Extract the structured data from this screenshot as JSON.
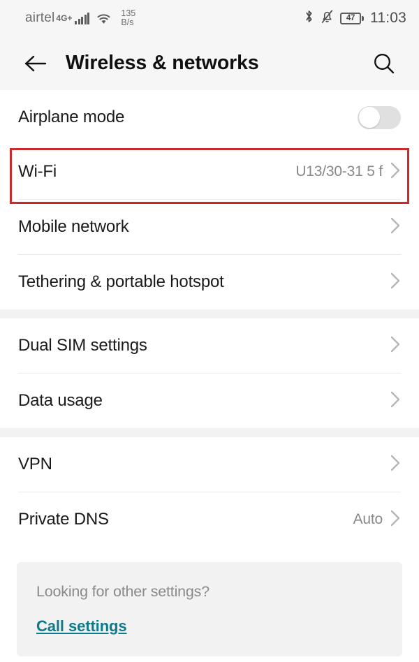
{
  "statusbar": {
    "carrier": "airtel",
    "network_type": "4G+",
    "signal_icon": "signal-bars-icon",
    "wifi_icon": "wifi-icon",
    "speed_value": "135",
    "speed_unit": "B/s",
    "bluetooth_icon": "bluetooth-icon",
    "silent_icon": "bell-muted-icon",
    "battery_percent": "47",
    "time": "11:03"
  },
  "appbar": {
    "back_icon": "back-arrow-icon",
    "title": "Wireless & networks",
    "search_icon": "search-icon"
  },
  "groups": [
    {
      "rows": [
        {
          "label": "Airplane mode",
          "value": "",
          "control": "toggle",
          "toggle_on": false
        }
      ]
    },
    {
      "rows": [
        {
          "label": "Wi-Fi",
          "value": "U13/30-31 5 f",
          "control": "chevron",
          "highlighted": true
        },
        {
          "label": "Mobile network",
          "value": "",
          "control": "chevron"
        },
        {
          "label": "Tethering & portable hotspot",
          "value": "",
          "control": "chevron"
        }
      ]
    },
    {
      "rows": [
        {
          "label": "Dual SIM settings",
          "value": "",
          "control": "chevron"
        },
        {
          "label": "Data usage",
          "value": "",
          "control": "chevron"
        }
      ]
    },
    {
      "rows": [
        {
          "label": "VPN",
          "value": "",
          "control": "chevron"
        },
        {
          "label": "Private DNS",
          "value": "Auto",
          "control": "chevron"
        }
      ]
    }
  ],
  "footer": {
    "question": "Looking for other settings?",
    "link": "Call settings"
  },
  "colors": {
    "highlight": "#c92a2a",
    "link": "#0e7b8c",
    "value_text": "#888888",
    "background": "#ffffff",
    "section_gap": "#f2f2f2"
  }
}
